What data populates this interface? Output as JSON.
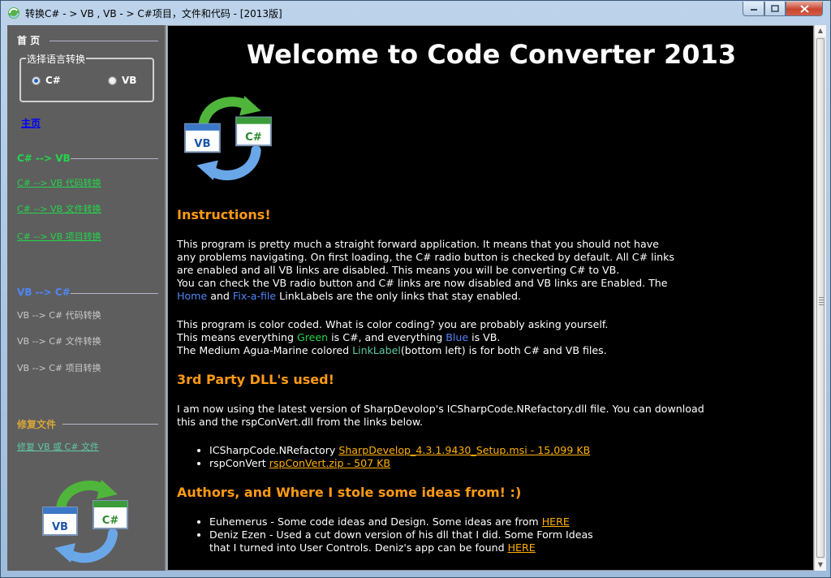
{
  "window": {
    "title": "转换C# - > VB , VB - > C#项目，文件和代码 - [2013版]"
  },
  "sidebar": {
    "home_header": "首 页",
    "lang_group_label": "选择语言转换",
    "radio_cs": {
      "label": "C#",
      "checked": true
    },
    "radio_vb": {
      "label": "VB",
      "checked": false
    },
    "home_link": "主页",
    "cs_to_vb_header": "C# --> VB",
    "cs_to_vb_links": [
      "C# --> VB 代码转换",
      "C# --> VB 文件转换",
      "C# --> VB 项目转换"
    ],
    "vb_to_cs_header": "VB --> C#",
    "vb_to_cs_links": [
      "VB --> C# 代码转换",
      "VB --> C# 文件转换",
      "VB --> C# 项目转换"
    ],
    "fix_header": "修复文件",
    "fix_link": "修复 VB 或 C# 文件",
    "logo_vb": "VB",
    "logo_cs": "C#"
  },
  "content": {
    "title": "Welcome to Code Converter 2013",
    "logo_vb": "VB",
    "logo_cs": "C#",
    "instructions_heading": "Instructions!",
    "instr_lines": [
      "This program is pretty much a straight forward application. It means that you should not have",
      "any problems navigating. On first loading, the C# radio button is checked by default. All C# links",
      "are enabled and all VB links are disabled. This means you will be converting C# to VB.",
      "You can check the VB radio button and C# links are now disabled and VB links are Enabled. The"
    ],
    "instr_last": {
      "home": "Home",
      "and": " and ",
      "fix": "Fix-a-file",
      "rest": " LinkLabels are the only links that stay enabled."
    },
    "color_line1": "This program is color coded. What is color coding? you are probably asking yourself.",
    "color_line2": {
      "a": "This means everything ",
      "green": "Green",
      "b": " is C#, and everything ",
      "blue": "Blue",
      "c": " is VB."
    },
    "color_line3": {
      "a": "The Medium Agua-Marine colored ",
      "link": "LinkLabel",
      "b": "(bottom left) is for both C# and VB files."
    },
    "dll_heading": "3rd Party DLL's used!",
    "dll_line1": "I am now using the latest version of SharpDevolop's ICSharpCode.NRefactory.dll file. You can download",
    "dll_line2": "this and the rspConVert.dll from the links below.",
    "dll_items": [
      {
        "name": "ICSharpCode.NRefactory ",
        "link": "SharpDevelop_4.3.1.9430_Setup.msi - 15,099 KB"
      },
      {
        "name": "rspConVert ",
        "link": "rspConVert.zip - 507 KB"
      }
    ],
    "authors_heading": "Authors, and Where I stole some ideas from! :)",
    "author1": {
      "text": "Euhemerus - Some code ideas and Design. Some ideas are from ",
      "link": "HERE"
    },
    "author2_line1": "Deniz Ezen - Used a cut down version of his dll that I did. Some Form Ideas",
    "author2_line2": {
      "text": "that I turned into User Controls. Deniz's app can be found ",
      "link": "HERE"
    }
  },
  "colors": {
    "sidebar_bg": "#5e5e5e",
    "cs_green": "#22d64a",
    "vb_blue": "#4f86f7",
    "aqua": "#5ec9a8",
    "heading_orange": "#ff9a14",
    "link_yellow": "#ffb000",
    "disabled_gray": "#c9c9c9",
    "fix_header": "#d8a63a"
  },
  "icons": [
    "app-icon",
    "minimize-icon",
    "maximize-icon",
    "close-icon",
    "vb-cs-convert-logo",
    "scroll-up-icon",
    "scroll-down-icon"
  ]
}
